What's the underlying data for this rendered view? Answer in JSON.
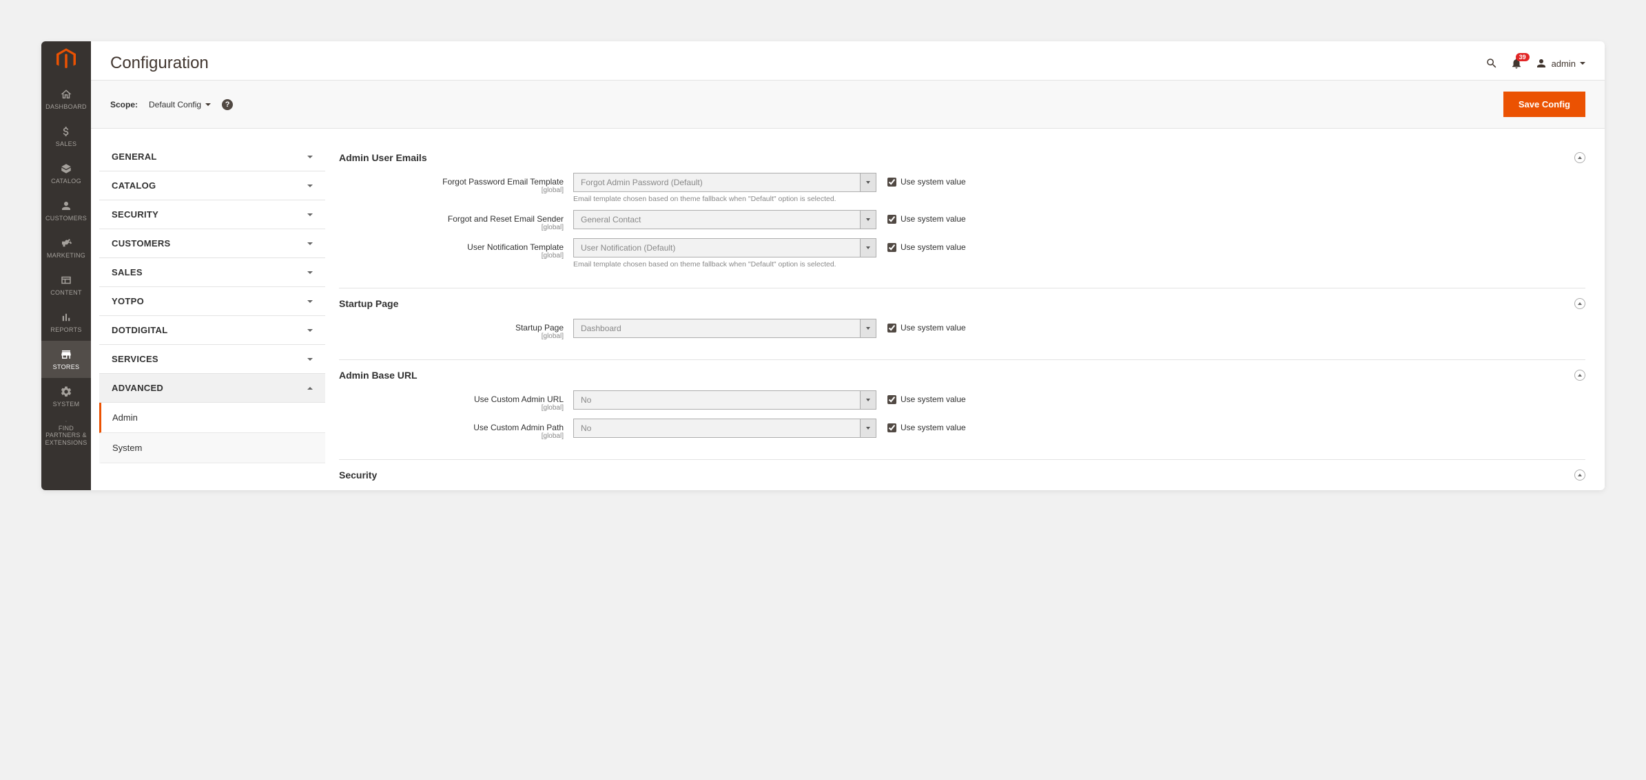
{
  "page_title": "Configuration",
  "notifications_count": "39",
  "admin_user": "admin",
  "scope": {
    "label": "Scope:",
    "value": "Default Config"
  },
  "save_button": "Save Config",
  "sidebar_nav": [
    {
      "label": "DASHBOARD",
      "icon": "dashboard-icon"
    },
    {
      "label": "SALES",
      "icon": "dollar-icon"
    },
    {
      "label": "CATALOG",
      "icon": "box-icon"
    },
    {
      "label": "CUSTOMERS",
      "icon": "person-icon"
    },
    {
      "label": "MARKETING",
      "icon": "megaphone-icon"
    },
    {
      "label": "CONTENT",
      "icon": "layout-icon"
    },
    {
      "label": "REPORTS",
      "icon": "chart-icon"
    },
    {
      "label": "STORES",
      "icon": "store-icon",
      "active": true
    },
    {
      "label": "SYSTEM",
      "icon": "gear-icon"
    },
    {
      "label": "FIND PARTNERS & EXTENSIONS",
      "icon": "partners-icon"
    }
  ],
  "config_nav": {
    "tabs": [
      {
        "label": "GENERAL"
      },
      {
        "label": "CATALOG"
      },
      {
        "label": "SECURITY"
      },
      {
        "label": "CUSTOMERS"
      },
      {
        "label": "SALES"
      },
      {
        "label": "YOTPO"
      },
      {
        "label": "DOTDIGITAL"
      },
      {
        "label": "SERVICES"
      }
    ],
    "advanced": {
      "label": "ADVANCED",
      "items": [
        {
          "label": "Admin",
          "active": true
        },
        {
          "label": "System"
        }
      ]
    }
  },
  "use_system_value_label": "Use system value",
  "scope_global": "[global]",
  "sections": {
    "admin_user_emails": {
      "title": "Admin User Emails",
      "fields": [
        {
          "label": "Forgot Password Email Template",
          "value": "Forgot Admin Password (Default)",
          "note": "Email template chosen based on theme fallback when \"Default\" option is selected."
        },
        {
          "label": "Forgot and Reset Email Sender",
          "value": "General Contact"
        },
        {
          "label": "User Notification Template",
          "value": "User Notification (Default)",
          "note": "Email template chosen based on theme fallback when \"Default\" option is selected."
        }
      ]
    },
    "startup_page": {
      "title": "Startup Page",
      "fields": [
        {
          "label": "Startup Page",
          "value": "Dashboard"
        }
      ]
    },
    "admin_base_url": {
      "title": "Admin Base URL",
      "fields": [
        {
          "label": "Use Custom Admin URL",
          "value": "No"
        },
        {
          "label": "Use Custom Admin Path",
          "value": "No"
        }
      ]
    },
    "security": {
      "title": "Security"
    }
  }
}
